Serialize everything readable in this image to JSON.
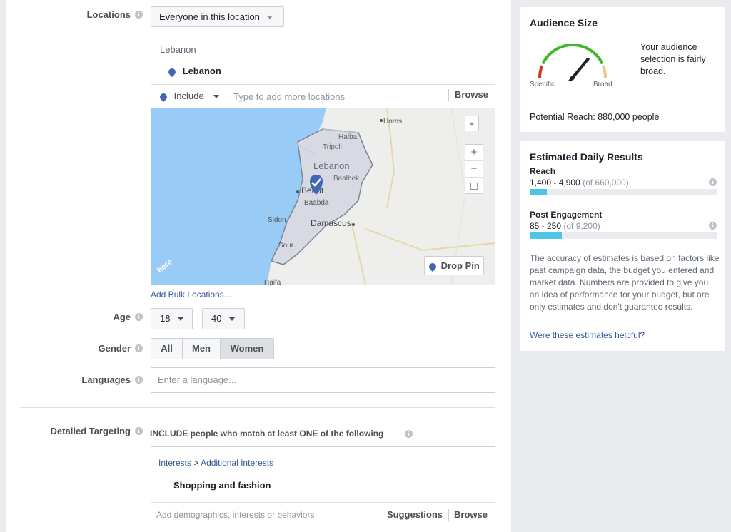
{
  "locations": {
    "label": "Locations",
    "dropdown": "Everyone in this location",
    "group_header": "Lebanon",
    "selected": "Lebanon",
    "include_label": "Include",
    "input_placeholder": "Type to add more locations",
    "browse": "Browse",
    "bulk_link": "Add Bulk Locations..."
  },
  "map": {
    "labels": {
      "homs": "Homs",
      "halba": "Halba",
      "tripoli": "Tripoli",
      "lebanon": "Lebanon",
      "baalbek": "Baalbek",
      "beirut": "Beirut",
      "baabda": "Baabda",
      "sidon": "Sidon",
      "damascus": "Damascus",
      "sour": "Sour",
      "haifa": "Haifa",
      "here": "here"
    },
    "zoom_in": "+",
    "zoom_out": "−",
    "drop_pin": "Drop Pin"
  },
  "age": {
    "label": "Age",
    "min": "18",
    "separator": "-",
    "max": "40"
  },
  "gender": {
    "label": "Gender",
    "options": [
      "All",
      "Men",
      "Women"
    ],
    "selected": "Women"
  },
  "languages": {
    "label": "Languages",
    "placeholder": "Enter a language..."
  },
  "detailed": {
    "label": "Detailed Targeting",
    "heading": "INCLUDE people who match at least ONE of the following",
    "crumb_1": "Interests",
    "crumb_sep": ">",
    "crumb_2": "Additional Interests",
    "interest": "Shopping and fashion",
    "input_placeholder": "Add demographics, interests or behaviors",
    "suggestions": "Suggestions",
    "browse": "Browse"
  },
  "audience": {
    "title": "Audience Size",
    "description": "Your audience selection is fairly broad.",
    "specific": "Specific",
    "broad": "Broad",
    "potential_reach": "Potential Reach: 880,000 people",
    "gauge_level": 0.72,
    "colors": {
      "red": "#d0321f",
      "green": "#42b72a",
      "orange": "#f5c08c",
      "needle": "#1d2129"
    }
  },
  "estimates": {
    "title": "Estimated Daily Results",
    "reach_label": "Reach",
    "reach_range": "1,400 - 4,900",
    "reach_total": "(of 660,000)",
    "reach_fill": 0.09,
    "engagement_label": "Post Engagement",
    "engagement_range": "85 - 250",
    "engagement_total": "(of 9,200)",
    "engagement_fill": 0.17,
    "bar_color": "#4dc4e8",
    "note": "The accuracy of estimates is based on factors like past campaign data, the budget you entered and market data. Numbers are provided to give you an idea of performance for your budget, but are only estimates and don't guarantee results.",
    "feedback_link": "Were these estimates helpful?"
  }
}
